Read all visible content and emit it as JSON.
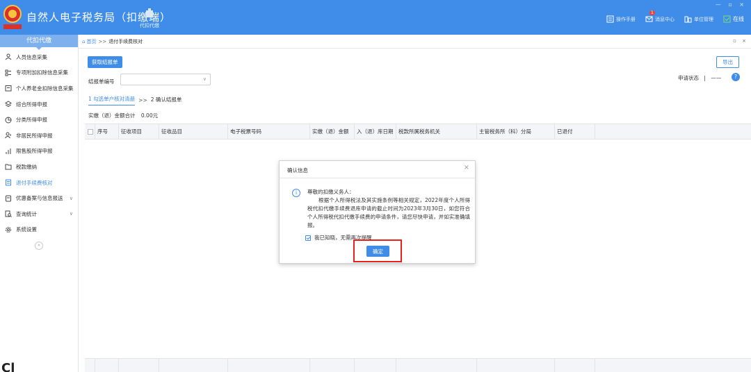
{
  "header": {
    "title": "自然人电子税务局（扣缴端）",
    "logo_text": "中国税务",
    "tool_label": "代扣代缴",
    "right_items": [
      {
        "label": "操作手册",
        "icon": "book-icon"
      },
      {
        "label": "消息中心",
        "icon": "mail-icon",
        "badge": "1"
      },
      {
        "label": "单位管理",
        "icon": "building-icon"
      },
      {
        "label": "在线",
        "icon": "online-check-icon"
      }
    ],
    "window_controls": "— ▫ ×"
  },
  "sidebar": {
    "title": "代扣代缴",
    "items": [
      {
        "label": "人员信息采集",
        "icon": "person-icon"
      },
      {
        "label": "专项附加扣除信息采集",
        "icon": "list-icon"
      },
      {
        "label": "个人养老金扣除信息采集",
        "icon": "calendar-icon"
      },
      {
        "label": "综合所得申报",
        "icon": "layers-icon"
      },
      {
        "label": "分类所得申报",
        "icon": "pie-icon"
      },
      {
        "label": "非居民所得申报",
        "icon": "person-outline-icon"
      },
      {
        "label": "限售股所得申报",
        "icon": "bar-chart-icon"
      },
      {
        "label": "税款缴纳",
        "icon": "folder-icon"
      },
      {
        "label": "退付手续费核对",
        "icon": "document-icon"
      },
      {
        "label": "优惠备案与信息报送",
        "icon": "report-icon"
      },
      {
        "label": "查询统计",
        "icon": "search-doc-icon"
      },
      {
        "label": "系统设置",
        "icon": "gear-icon"
      }
    ],
    "collapse_glyph": "«",
    "watermark": "Cl"
  },
  "breadcrumb": {
    "home": "首页",
    "sep": ">>",
    "current": "退付手续费核对",
    "controls": "▫ ×"
  },
  "toolbar": {
    "fetch_label": "获取结报单",
    "export_label": "导出"
  },
  "filter": {
    "bill_no_label": "结报单编号",
    "status_label": "申请状态",
    "status_sep": "|",
    "status_value": "——"
  },
  "steps": {
    "step1": "1 勾选单户核对清册",
    "sep": ">>",
    "step2": "2 确认结报单"
  },
  "total": {
    "label": "实缴（退）金额合计",
    "value": "0.00元"
  },
  "table": {
    "columns": [
      "序号",
      "征收项目",
      "征收品目",
      "电子税票号码",
      "实缴（退）金额",
      "入（退）库日期",
      "税款所属税务机关",
      "主管税务所（科）分局",
      "已退付"
    ]
  },
  "modal": {
    "title": "确认信息",
    "close": "×",
    "greeting": "尊敬的扣缴义务人：",
    "body": "根据个人所得税法及其实施条例等相关规定，2022年度个人所得税代扣代缴手续费退库申请的截止时间为2023年3月30日，如您符合个人所得税代扣代缴手续费的申请条件，请您尽快申请，并如实准确填报。",
    "checkbox_label": "我已知晓，无需再次提醒",
    "checkbox_checked": true,
    "ok_label": "确定"
  }
}
